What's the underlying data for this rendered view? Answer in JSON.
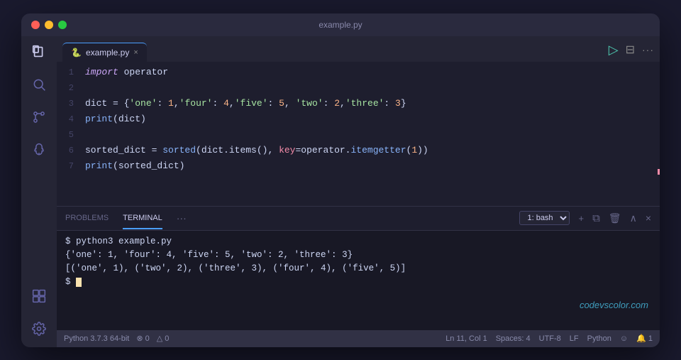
{
  "window": {
    "title": "example.py"
  },
  "tab": {
    "filename": "example.py",
    "close_label": "×"
  },
  "tab_actions": {
    "run": "▷",
    "split": "⊟",
    "more": "···"
  },
  "code": {
    "lines": [
      {
        "num": "1",
        "content": "import operator"
      },
      {
        "num": "2",
        "content": ""
      },
      {
        "num": "3",
        "content": "dict = {'one': 1,'four': 4,'five': 5, 'two': 2,'three': 3}"
      },
      {
        "num": "4",
        "content": "print(dict)"
      },
      {
        "num": "5",
        "content": ""
      },
      {
        "num": "6",
        "content": "sorted_dict = sorted(dict.items(), key=operator.itemgetter(1))"
      },
      {
        "num": "7",
        "content": "print(sorted_dict)"
      }
    ]
  },
  "terminal": {
    "tabs": [
      "PROBLEMS",
      "TERMINAL"
    ],
    "active_tab": "TERMINAL",
    "more_label": "···",
    "shell_label": "1: bash",
    "controls": [
      "+",
      "⧉",
      "🗑",
      "∧",
      "×"
    ],
    "output": [
      "$ python3 example.py",
      "{'one': 1, 'four': 4, 'five': 5, 'two': 2, 'three': 3}",
      "[('one', 1), ('two', 2), ('three', 3), ('four', 4), ('five', 5)]",
      "$ "
    ]
  },
  "status_bar": {
    "python_version": "Python 3.7.3 64-bit",
    "errors": "⊗ 0",
    "warnings": "△ 0",
    "ln_col": "Ln 11, Col 1",
    "spaces": "Spaces: 4",
    "encoding": "UTF-8",
    "line_ending": "LF",
    "language": "Python",
    "smiley": "☺",
    "bell": "🔔 1"
  },
  "watermark": "codevscolor.com",
  "activity_bar": {
    "icons": [
      "files",
      "search",
      "source-control",
      "debug",
      "extensions",
      "settings"
    ]
  }
}
